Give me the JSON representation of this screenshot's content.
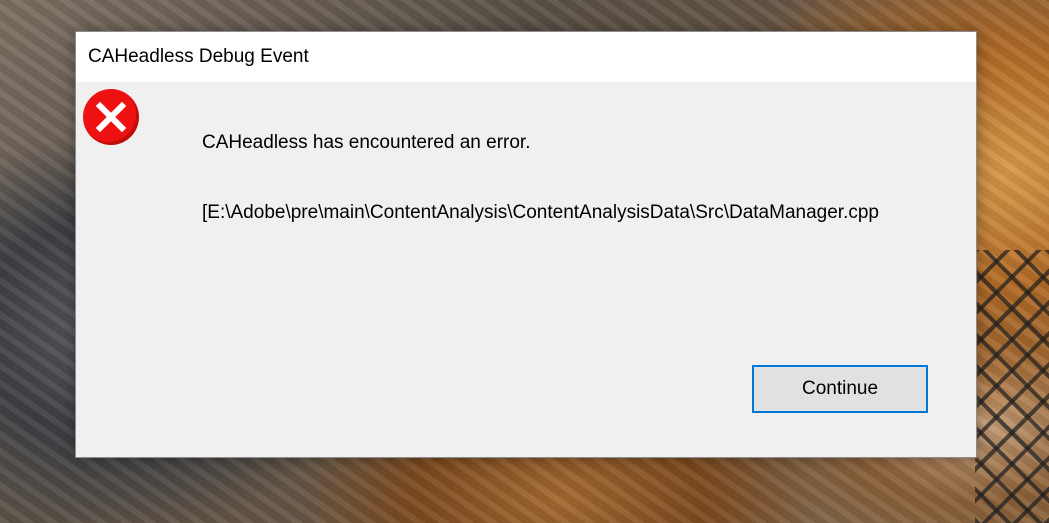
{
  "dialog": {
    "title": "CAHeadless Debug Event",
    "icon": "error-icon",
    "message": "CAHeadless has encountered an error.",
    "detail": "[E:\\Adobe\\pre\\main\\ContentAnalysis\\ContentAnalysisData\\Src\\DataManager.cpp",
    "continue_label": "Continue"
  },
  "colors": {
    "error_red": "#ee1111",
    "focus_border": "#0078d7",
    "dialog_bg": "#f0f0f0"
  }
}
